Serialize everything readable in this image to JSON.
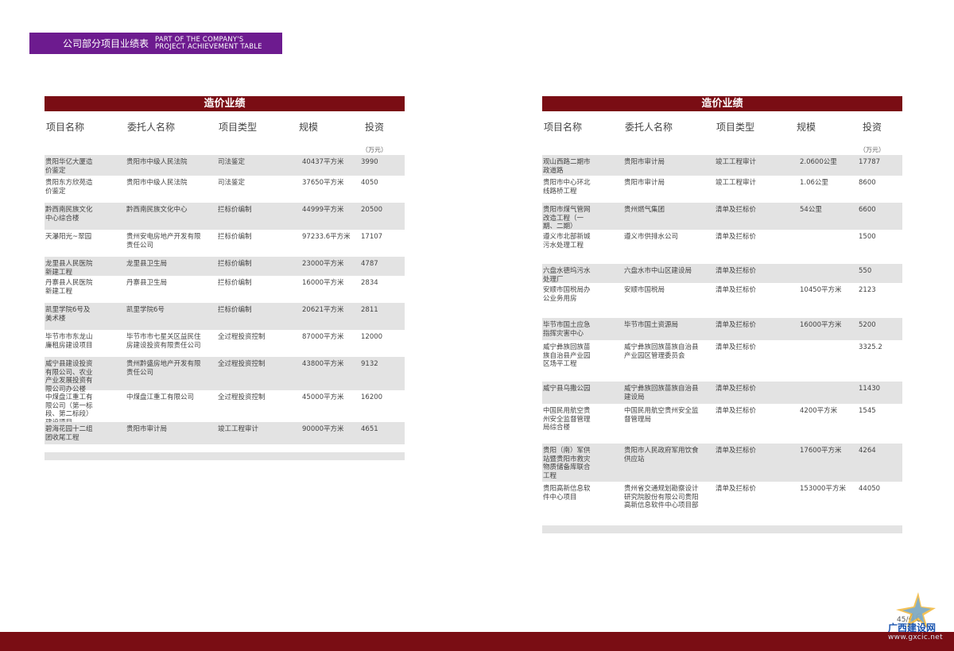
{
  "banner": {
    "title_cn": "公司部分项目业绩表",
    "title_en_line1": "PART OF THE COMPANY'S",
    "title_en_line2": "PROJECT ACHIEVEMENT TABLE"
  },
  "headers": {
    "section_title": "造价业绩",
    "name": "项目名称",
    "client": "委托人名称",
    "type": "项目类型",
    "scale": "规模",
    "investment": "投资",
    "investment_unit": "（万元）"
  },
  "left_rows": [
    {
      "name": "贵阳华亿大厦造价鉴定",
      "client": "贵阳市中级人民法院",
      "type": "司法鉴定",
      "scale": "40437平方米",
      "investment": "3990"
    },
    {
      "name": "贵阳东方欣苑造价鉴定",
      "client": "贵阳市中级人民法院",
      "type": "司法鉴定",
      "scale": "37650平方米",
      "investment": "4050"
    },
    {
      "name": "黔西南民族文化中心综合楼",
      "client": "黔西南民族文化中心",
      "type": "拦标价编制",
      "scale": "44999平方米",
      "investment": "20500"
    },
    {
      "name": "天瀑阳光~翠园",
      "client": "贵州安电房地产开发有限责任公司",
      "type": "拦标价编制",
      "scale": "97233.6平方米",
      "investment": "17107"
    },
    {
      "name": "龙里县人民医院新建工程",
      "client": "龙里县卫生局",
      "type": "拦标价编制",
      "scale": "23000平方米",
      "investment": "4787"
    },
    {
      "name": "丹寨县人民医院新建工程",
      "client": "丹寨县卫生局",
      "type": "拦标价编制",
      "scale": "16000平方米",
      "investment": "2834"
    },
    {
      "name": "凯里学院6号及美术楼",
      "client": "凯里学院6号",
      "type": "拦标价编制",
      "scale": "20621平方米",
      "investment": "2811"
    },
    {
      "name": "毕节市市东龙山廉租房建设项目",
      "client": "毕节市市七星关区益民住房建设投资有限责任公司",
      "type": "全过程投资控制",
      "scale": "87000平方米",
      "investment": "12000"
    },
    {
      "name": "威宁县建设投资有限公司、农业产业发展投资有限公司办公楼",
      "client": "贵州黔盛房地产开发有限责任公司",
      "type": "全过程投资控制",
      "scale": "43800平方米",
      "investment": "9132"
    },
    {
      "name": "中煤盘江重工有限公司（第一标段、第二标段）建设项目",
      "client": "中煤盘江重工有限公司",
      "type": "全过程投资控制",
      "scale": "45000平方米",
      "investment": "16200"
    },
    {
      "name": "碧海花园十二组团收尾工程",
      "client": "贵阳市审计局",
      "type": "竣工工程审计",
      "scale": "90000平方米",
      "investment": "4651"
    }
  ],
  "right_rows": [
    {
      "name": "观山西路二期市政道路",
      "client": "贵阳市审计局",
      "type": "竣工工程审计",
      "scale": "2.0600公里",
      "investment": "17787"
    },
    {
      "name": "贵阳市中心环北线路桥工程",
      "client": "贵阳市审计局",
      "type": "竣工工程审计",
      "scale": "1.06公里",
      "investment": "8600"
    },
    {
      "name": "贵阳市煤气管网改造工程（一期、二期）",
      "client": "贵州燃气集团",
      "type": "清单及拦标价",
      "scale": "54公里",
      "investment": "6600"
    },
    {
      "name": "遵义市北部新城污水处理工程",
      "client": "遵义市供排水公司",
      "type": "清单及拦标价",
      "scale": "",
      "investment": "1500"
    },
    {
      "name": "六盘水德坞污水处理厂",
      "client": "六盘水市中山区建设局",
      "type": "清单及拦标价",
      "scale": "",
      "investment": "550"
    },
    {
      "name": "安顺市国税局办公业务用房",
      "client": "安顺市国税局",
      "type": "清单及拦标价",
      "scale": "10450平方米",
      "investment": "2123"
    },
    {
      "name": "毕节市国土应急指挥灾害中心",
      "client": "毕节市国土资源局",
      "type": "清单及拦标价",
      "scale": "16000平方米",
      "investment": "5200"
    },
    {
      "name": "威宁彝族回族苗族自治县产业园区场平工程",
      "client": "威宁彝族回族苗族自治县产业园区管理委员会",
      "type": "清单及拦标价",
      "scale": "",
      "investment": "3325.2"
    },
    {
      "name": "威宁县乌撒公园",
      "client": "威宁彝族回族苗族自治县建设局",
      "type": "清单及拦标价",
      "scale": "",
      "investment": "11430"
    },
    {
      "name": "中国民用航空贵州安全监督管理局综合楼",
      "client": "中国民用航空贵州安全监督管理局",
      "type": "清单及拦标价",
      "scale": "4200平方米",
      "investment": "1545"
    },
    {
      "name": "贵阳（南）军供站暨贵阳市救灾物质储备库联合工程",
      "client": "贵阳市人民政府军用饮食供应站",
      "type": "清单及拦标价",
      "scale": "17600平方米",
      "investment": "4264"
    },
    {
      "name": "贵阳高新信息软件中心项目",
      "client": "贵州省交通规划勘察设计研究院股份有限公司贵阳高新信息软件中心项目部",
      "type": "清单及拦标价",
      "scale": "153000平方米",
      "investment": "44050"
    }
  ],
  "page_numbers": {
    "left": "45",
    "right": "46"
  },
  "watermark": {
    "text": "广西建设网",
    "url": "www.gxcic.net"
  },
  "colors": {
    "banner": "#6d1b8f",
    "header_bar": "#7a0d14",
    "row_shade": "#e3e3e3"
  }
}
